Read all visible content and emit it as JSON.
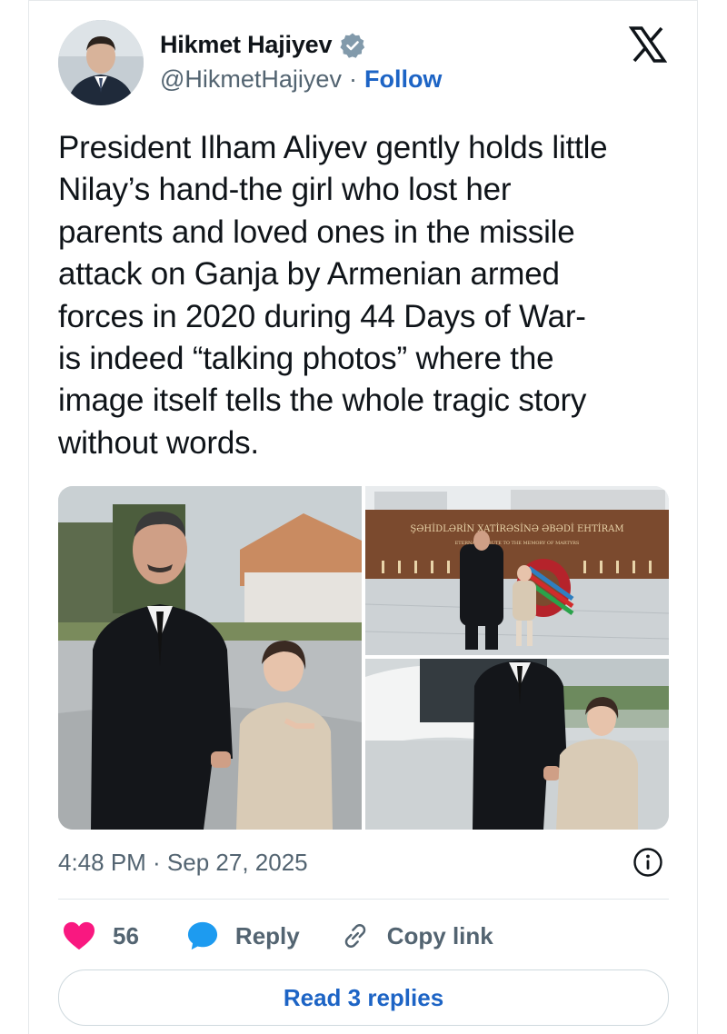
{
  "author": {
    "name": "Hikmet Hajiyev",
    "handle": "@HikmetHajiyev",
    "separator": "·",
    "follow_label": "Follow"
  },
  "tweet": {
    "text": "President Ilham Aliyev gently holds little\nNilay’s hand-the girl who lost her\nparents and loved ones in the missile\nattack on Ganja by Armenian armed\nforces in 2020 during 44 Days of War-\nis indeed “talking photos” where the\nimage itself tells the whole tragic story\nwithout words."
  },
  "media": {
    "memorial_sign_line1": "ŞƏHİDLƏRİN XATİRƏSİNƏ ƏBƏDİ EHTİRAM",
    "memorial_sign_line2": "ETERNAL TRIBUTE TO THE MEMORY OF MARTYRS"
  },
  "meta": {
    "timestamp": "4:48 PM · Sep 27, 2025"
  },
  "actions": {
    "like_count": "56",
    "reply_label": "Reply",
    "copy_label": "Copy link"
  },
  "replies_button": "Read 3 replies",
  "colors": {
    "accent": "#1d64c5",
    "like": "#f91880",
    "verified": "#829aab",
    "reply_icon": "#1d9bf0"
  },
  "icons": [
    "verified-badge-icon",
    "x-logo-icon",
    "info-icon",
    "heart-icon",
    "reply-bubble-icon",
    "link-icon"
  ]
}
